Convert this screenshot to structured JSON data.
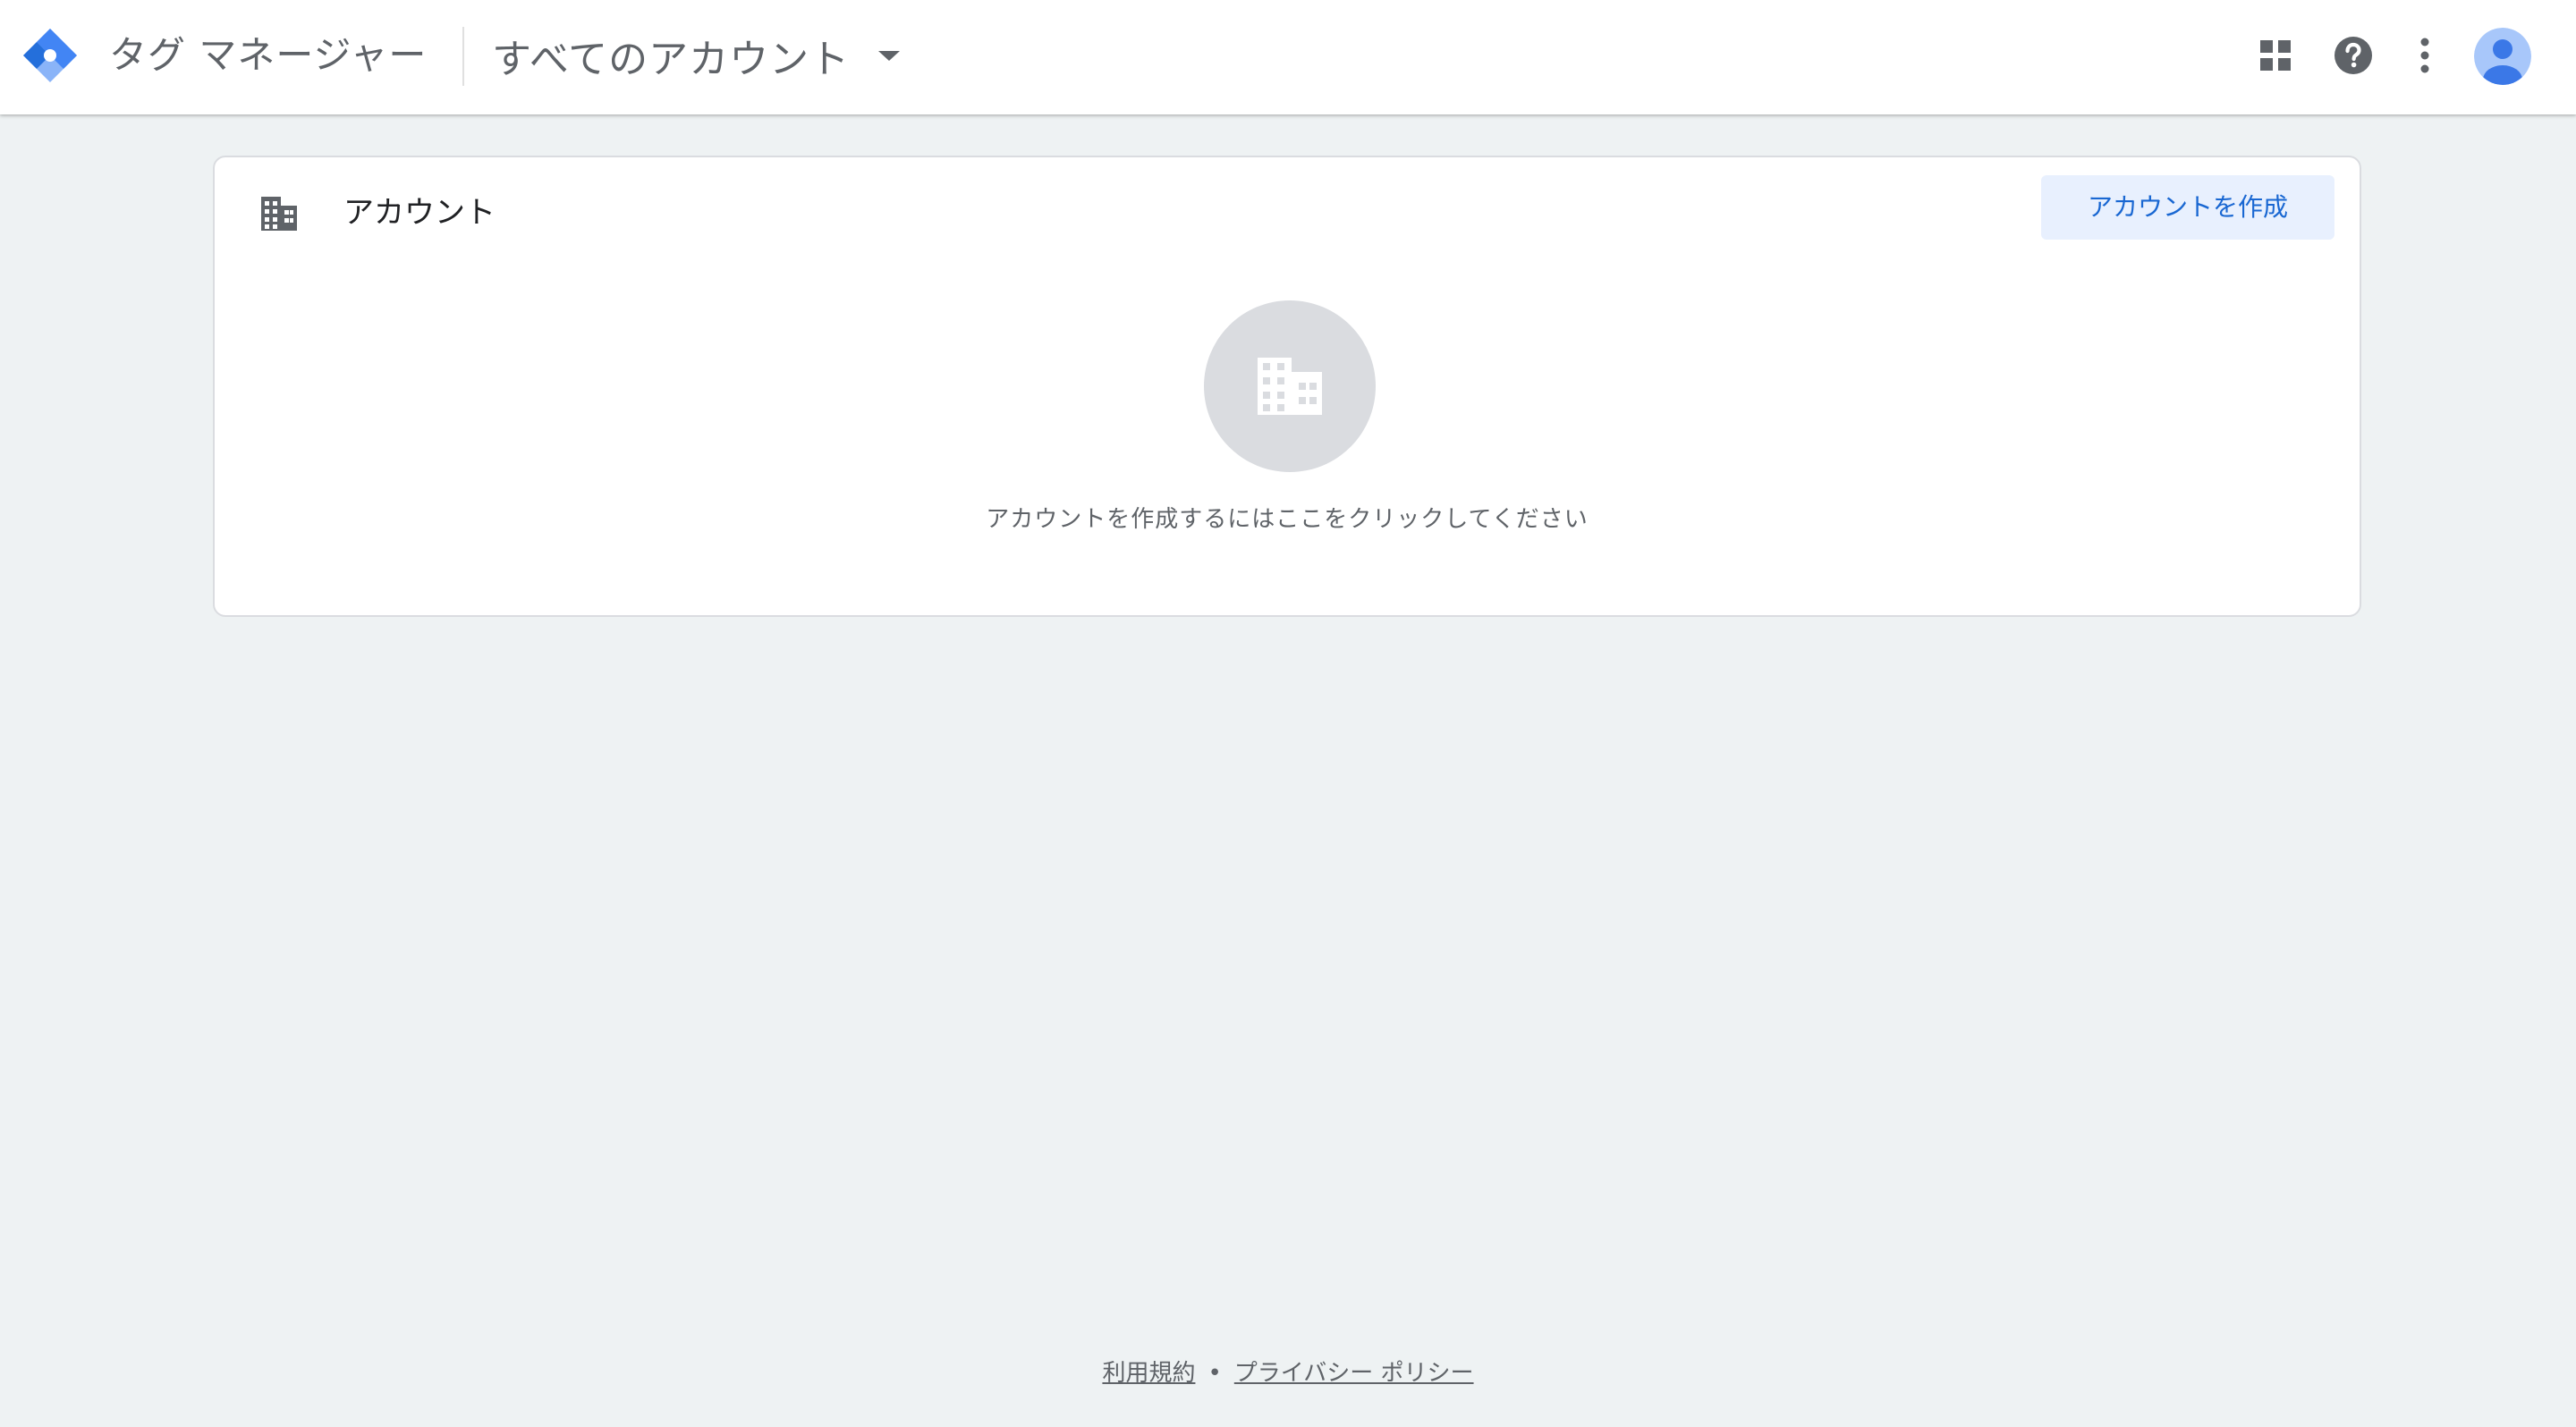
{
  "header": {
    "product_name": "タグ マネージャー",
    "account_selector_label": "すべてのアカウント"
  },
  "account_card": {
    "title": "アカウント",
    "create_button_label": "アカウントを作成",
    "empty_state_message": "アカウントを作成するにはここをクリックしてください"
  },
  "footer": {
    "terms_link": "利用規約",
    "separator": "•",
    "privacy_link": "プライバシー ポリシー"
  },
  "colors": {
    "page_background": "#eef2f3",
    "header_background": "#ffffff",
    "accent_blue": "#1967d2",
    "button_background": "#e8f0fe",
    "logo_light_blue": "#8ab4f8",
    "logo_blue": "#4285f4",
    "logo_dark_blue": "#246fdb",
    "icon_gray": "#5f6368",
    "empty_state_circle": "#dadce0"
  },
  "icons": {
    "logo": "tag-manager-logo-icon",
    "dropdown": "arrow-drop-down-icon",
    "apps": "apps-grid-icon",
    "help": "help-icon",
    "more": "more-vert-icon",
    "avatar": "account-avatar-icon",
    "building": "building-icon"
  }
}
